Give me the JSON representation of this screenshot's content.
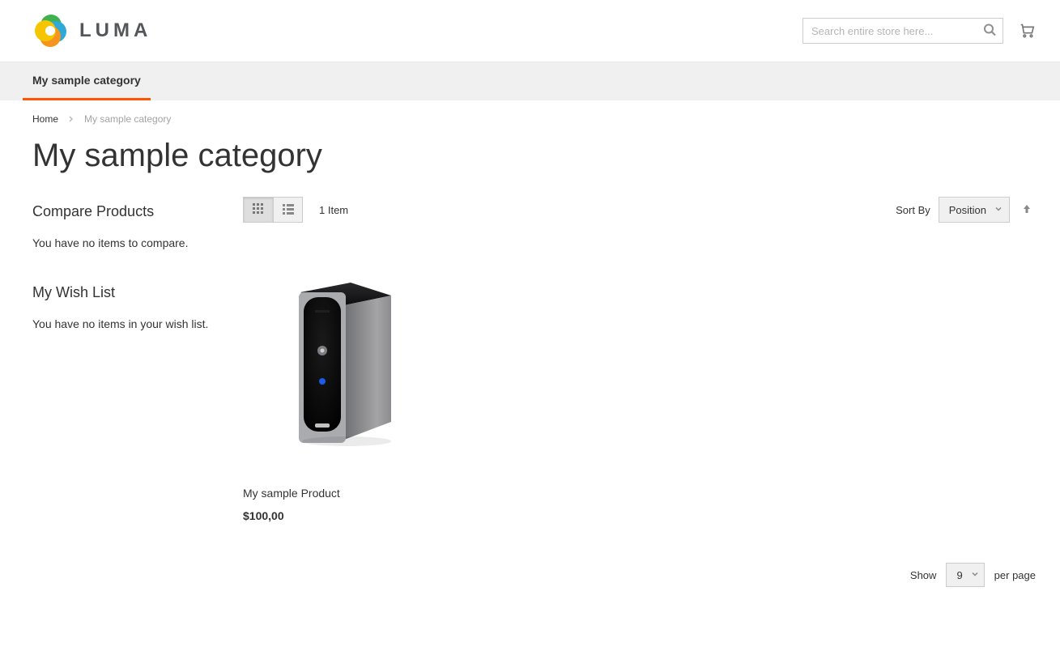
{
  "header": {
    "logo_text": "LUMA",
    "search_placeholder": "Search entire store here..."
  },
  "nav": {
    "items": [
      {
        "label": "My sample category"
      }
    ]
  },
  "breadcrumbs": {
    "home": "Home",
    "current": "My sample category"
  },
  "page": {
    "title": "My sample category"
  },
  "sidebar": {
    "compare_title": "Compare Products",
    "compare_empty": "You have no items to compare.",
    "wishlist_title": "My Wish List",
    "wishlist_empty": "You have no items in your wish list."
  },
  "toolbar": {
    "item_count": "1 Item",
    "sort_by_label": "Sort By",
    "sort_by_value": "Position",
    "show_label": "Show",
    "page_size": "9",
    "per_page_label": "per page"
  },
  "products": [
    {
      "name": "My sample Product",
      "price": "$100,00"
    }
  ]
}
